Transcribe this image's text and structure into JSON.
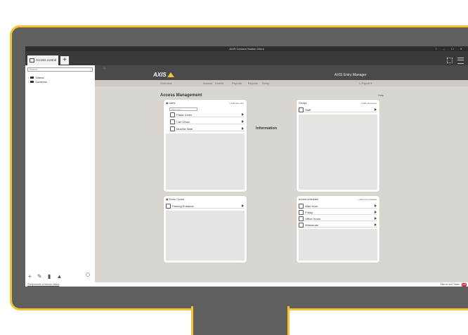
{
  "window": {
    "title": "AXIS Camera Station Client",
    "controls": "?  –  ☐  ✕"
  },
  "tabs": [
    {
      "label": "Access control"
    }
  ],
  "sidebar": {
    "search_placeholder": "Search...",
    "tree": [
      {
        "label": "Videos"
      },
      {
        "label": "Cameras"
      }
    ]
  },
  "app": {
    "title": "AXIS Entry Manager",
    "nav": [
      {
        "label": "Overview"
      },
      {
        "label": "Access"
      },
      {
        "label": "Events"
      },
      {
        "label": "Reports"
      },
      {
        "label": "Reports"
      },
      {
        "label": "Setup"
      }
    ],
    "export_label": "Export",
    "page_heading": "Access Management",
    "help_label": "Help",
    "information_label": "Information"
  },
  "panels": {
    "users": {
      "header": "Users",
      "add_label": "+ Add new user",
      "filter_placeholder": "Filter users",
      "items": [
        {
          "label": "Paula Jones"
        },
        {
          "label": "Carl Orosz"
        },
        {
          "label": "Mozelle Watt"
        }
      ]
    },
    "groups": {
      "header": "Groups",
      "add_label": "+ Add new group",
      "items": [
        {
          "label": "Staff"
        }
      ]
    },
    "doors": {
      "header": "Doors / Zones",
      "items": [
        {
          "label": "Parking Entrance"
        }
      ]
    },
    "schedules": {
      "header": "Access schedules",
      "add_label": "+ Add new schedule",
      "items": [
        {
          "label": "After Hour"
        },
        {
          "label": "Friday"
        },
        {
          "label": "Office Hours"
        },
        {
          "label": "Weekends"
        }
      ]
    }
  },
  "statusbar": {
    "left_link": "Components & license status",
    "right_text": "Alarms and Tasks",
    "badge": "199"
  },
  "colors": {
    "bezel": "#5f5f5f",
    "bezel_accent": "#f4c430",
    "app_background": "#d9d6d1",
    "badge": "#dd2233"
  }
}
